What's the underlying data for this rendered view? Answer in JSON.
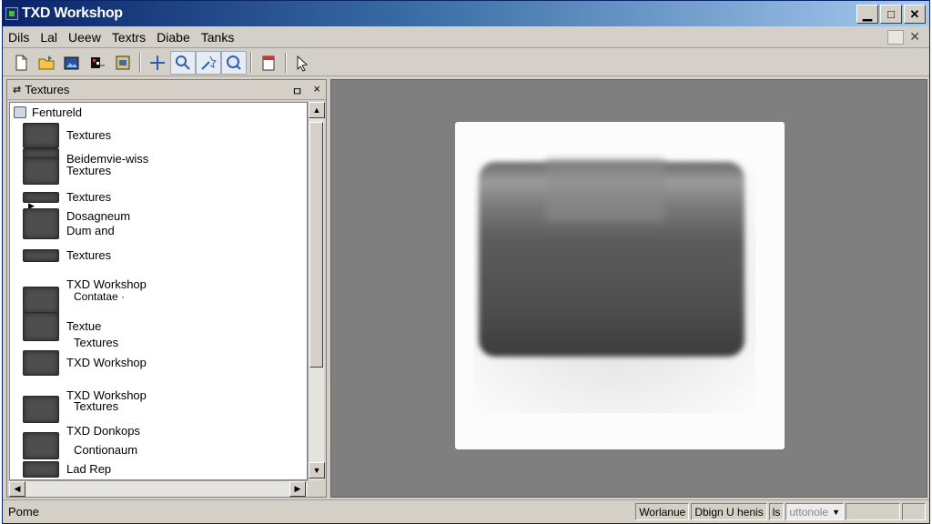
{
  "window": {
    "title": "TXD Workshop"
  },
  "title_buttons": {
    "minimize": "▁",
    "maximize": "□",
    "close": "✕"
  },
  "menubar": {
    "items": [
      {
        "label": "Dils"
      },
      {
        "label": "Lal"
      },
      {
        "label": "Ueew"
      },
      {
        "label": "Textrs"
      },
      {
        "label": "Diabe"
      },
      {
        "label": "Tanks"
      }
    ],
    "close_glyph": "✕"
  },
  "toolbar": {
    "tools": [
      {
        "icon": "new-file-icon"
      },
      {
        "icon": "open-folder-icon"
      },
      {
        "icon": "import-image-icon"
      },
      {
        "icon": "export-icon"
      },
      {
        "icon": "properties-icon"
      },
      {
        "icon": "move-icon"
      },
      {
        "icon": "search-icon"
      },
      {
        "icon": "pick-icon"
      },
      {
        "icon": "zoom-icon"
      },
      {
        "icon": "document-icon"
      },
      {
        "icon": "pointer-tool-icon"
      }
    ]
  },
  "panel": {
    "title": "Textures",
    "pin": "ㅁ",
    "close": "×",
    "root_label": "Fentureld",
    "items": [
      {
        "label": "Textures"
      },
      {
        "label": "Beidemvie-wiss"
      },
      {
        "label": "Textures"
      },
      {
        "label": "Textures"
      },
      {
        "label": "Dosagneum\nDum and"
      },
      {
        "label": "Textures"
      },
      {
        "label": "TXD Workshop"
      },
      {
        "label": "Contatae  ·"
      },
      {
        "label": "Textue"
      },
      {
        "label": "Textures"
      },
      {
        "label": "TXD Workshop"
      },
      {
        "label": "TXD Workshop"
      },
      {
        "label": "Textures"
      },
      {
        "label": "TXD Donkops"
      },
      {
        "label": "Contionaum"
      },
      {
        "label": "Lad Rep"
      }
    ]
  },
  "statusbar": {
    "left": "Pome",
    "fields": [
      "Worlanue",
      "Dbign U henis",
      "ls",
      "uttonole"
    ]
  }
}
